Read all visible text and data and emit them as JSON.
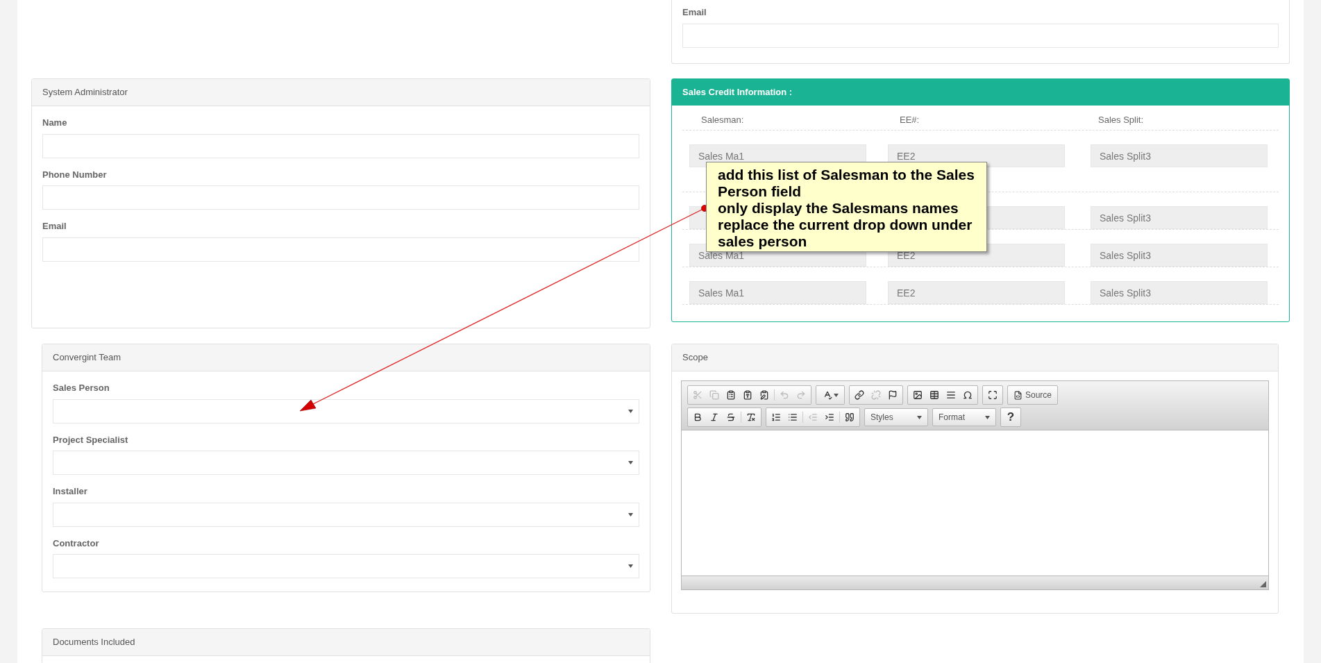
{
  "contact_panel": {
    "fields": [
      {
        "label": "Email"
      }
    ]
  },
  "system_admin": {
    "title": "System Administrator",
    "fields": [
      {
        "label": "Name"
      },
      {
        "label": "Phone Number"
      },
      {
        "label": "Email"
      }
    ]
  },
  "sales_credit": {
    "title": "Sales Credit Information :",
    "columns": [
      "Salesman:",
      "EE#:",
      "Sales Split:"
    ],
    "rows": [
      {
        "salesman": "Sales Ma1",
        "ee": "EE2",
        "split": "Sales Split3"
      },
      {
        "split": "Sales Split3"
      },
      {
        "salesman": "Sales Ma1",
        "ee": "EE2",
        "split": "Sales Split3"
      },
      {
        "salesman": "Sales Ma1",
        "ee": "EE2",
        "split": "Sales Split3"
      }
    ]
  },
  "team": {
    "title": "Convergint Team",
    "fields": [
      {
        "label": "Sales Person"
      },
      {
        "label": "Project Specialist"
      },
      {
        "label": "Installer"
      },
      {
        "label": "Contractor"
      }
    ]
  },
  "documents": {
    "title": "Documents Included"
  },
  "scope": {
    "title": "Scope",
    "toolbar": [
      [
        [
          {
            "kind": "icon",
            "disabled": true
          },
          {
            "kind": "icon",
            "disabled": true
          },
          {
            "kind": "icon",
            "disabled": false
          },
          {
            "kind": "icon",
            "disabled": false
          },
          {
            "kind": "icon",
            "disabled": false
          },
          {
            "kind": "separator"
          },
          {
            "kind": "icon",
            "disabled": true
          },
          {
            "kind": "icon",
            "disabled": true
          }
        ],
        [
          {
            "kind": "icon_menu",
            "disabled": false
          }
        ],
        [
          {
            "kind": "icon",
            "disabled": false
          },
          {
            "kind": "icon",
            "disabled": true
          },
          {
            "kind": "icon",
            "disabled": false
          }
        ],
        [
          {
            "kind": "icon",
            "disabled": false
          },
          {
            "kind": "icon",
            "disabled": false
          },
          {
            "kind": "icon",
            "disabled": false
          },
          {
            "kind": "icon",
            "disabled": false
          }
        ],
        [
          {
            "kind": "icon",
            "disabled": false
          }
        ],
        [
          {
            "kind": "labeled_icon",
            "label": "Source",
            "disabled": false
          }
        ]
      ],
      [
        [
          {
            "kind": "icon",
            "disabled": false
          },
          {
            "kind": "icon",
            "disabled": false
          },
          {
            "kind": "icon",
            "disabled": false
          },
          {
            "kind": "separator"
          },
          {
            "kind": "icon",
            "disabled": false
          }
        ],
        [
          {
            "kind": "icon",
            "disabled": false
          },
          {
            "kind": "icon",
            "disabled": false
          },
          {
            "kind": "separator"
          },
          {
            "kind": "icon",
            "disabled": true
          },
          {
            "kind": "icon",
            "disabled": false
          },
          {
            "kind": "separator"
          },
          {
            "kind": "icon",
            "disabled": false
          }
        ],
        [
          {
            "kind": "combo",
            "label": "Styles"
          }
        ],
        [
          {
            "kind": "combo",
            "label": "Format"
          }
        ],
        [
          {
            "kind": "text",
            "label": "?"
          }
        ]
      ]
    ]
  },
  "callout": {
    "lines": [
      "add this list of Salesman to the Sales Person field",
      "only display the Salesmans names",
      "replace the current drop down under sales person"
    ]
  }
}
